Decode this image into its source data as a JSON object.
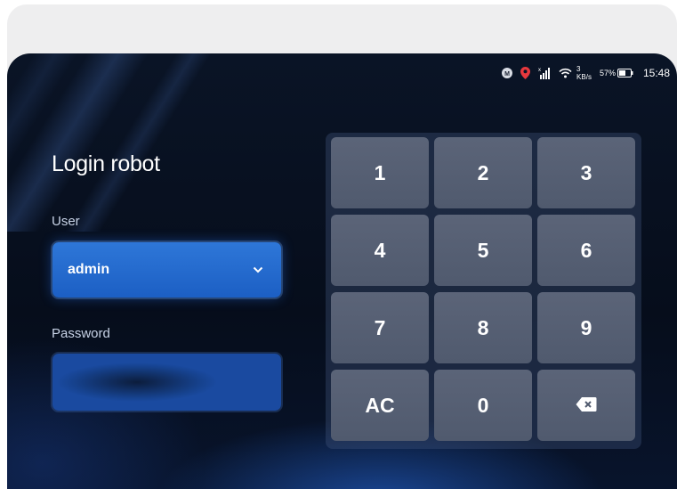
{
  "status_bar": {
    "icons": [
      "m-badge-icon",
      "location-icon",
      "signal-icon",
      "wifi-icon",
      "battery-icon"
    ],
    "network_speed_value": "3",
    "network_speed_unit": "KB/s",
    "battery_percent": "57%",
    "time": "15:48"
  },
  "login": {
    "title": "Login robot",
    "user_label": "User",
    "user_value": "admin",
    "password_label": "Password",
    "password_value": ""
  },
  "keypad": {
    "keys": [
      "1",
      "2",
      "3",
      "4",
      "5",
      "6",
      "7",
      "8",
      "9",
      "AC",
      "0",
      ""
    ]
  },
  "colors": {
    "background": "#060d1b",
    "accent": "#2e77d8",
    "key": "#5b6478",
    "text": "#ffffff"
  }
}
